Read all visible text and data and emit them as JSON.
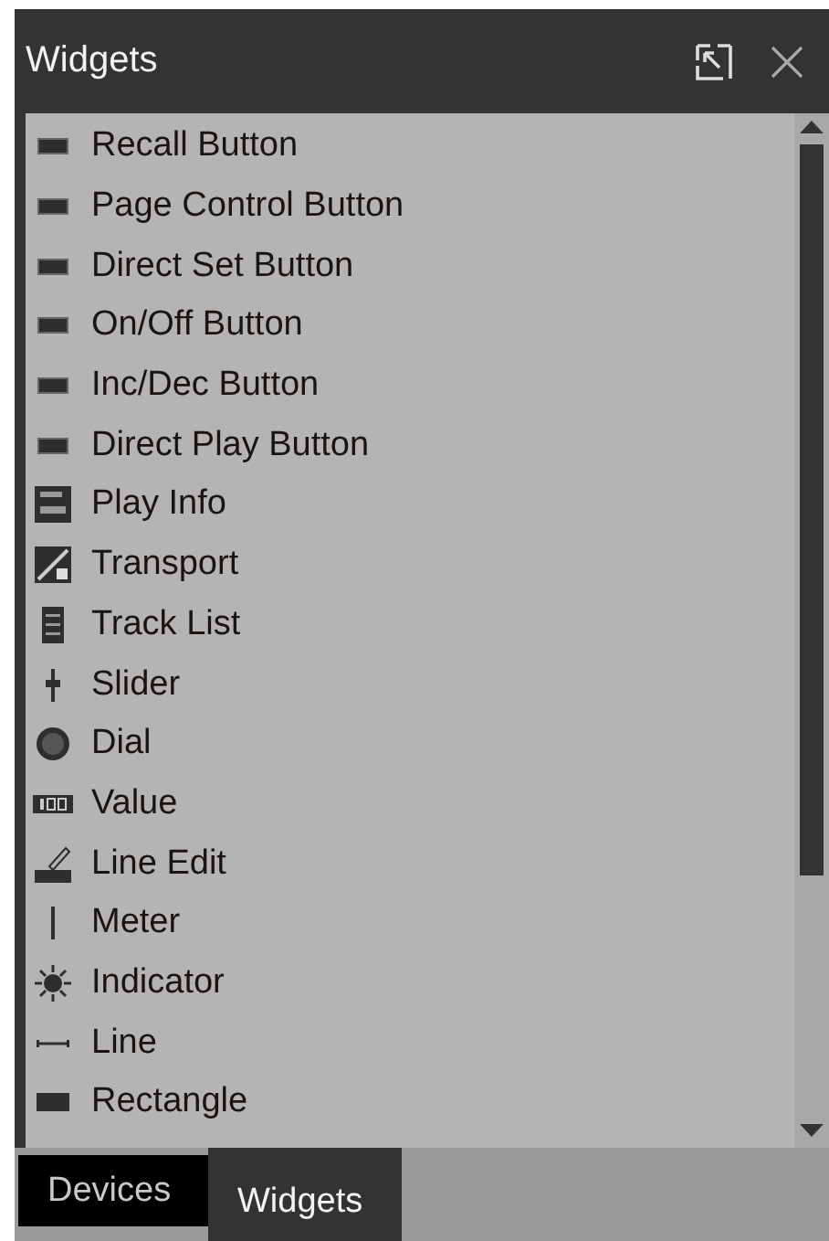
{
  "panel": {
    "title": "Widgets"
  },
  "widgets": [
    {
      "label": "Recall Button",
      "kind": "button"
    },
    {
      "label": "Page Control Button",
      "kind": "button"
    },
    {
      "label": "Direct Set Button",
      "kind": "button"
    },
    {
      "label": "On/Off Button",
      "kind": "button"
    },
    {
      "label": "Inc/Dec Button",
      "kind": "button"
    },
    {
      "label": "Direct Play Button",
      "kind": "button"
    },
    {
      "label": "Play Info",
      "kind": "playinfo"
    },
    {
      "label": "Transport",
      "kind": "transport"
    },
    {
      "label": "Track List",
      "kind": "tracklist"
    },
    {
      "label": "Slider",
      "kind": "slider"
    },
    {
      "label": "Dial",
      "kind": "dial"
    },
    {
      "label": "Value",
      "kind": "value"
    },
    {
      "label": "Line Edit",
      "kind": "lineedit"
    },
    {
      "label": "Meter",
      "kind": "meter"
    },
    {
      "label": "Indicator",
      "kind": "indicator"
    },
    {
      "label": "Line",
      "kind": "line"
    },
    {
      "label": "Rectangle",
      "kind": "rectangle"
    }
  ],
  "tabs": [
    {
      "label": "Devices",
      "selected": false
    },
    {
      "label": "Widgets",
      "selected": true
    }
  ]
}
